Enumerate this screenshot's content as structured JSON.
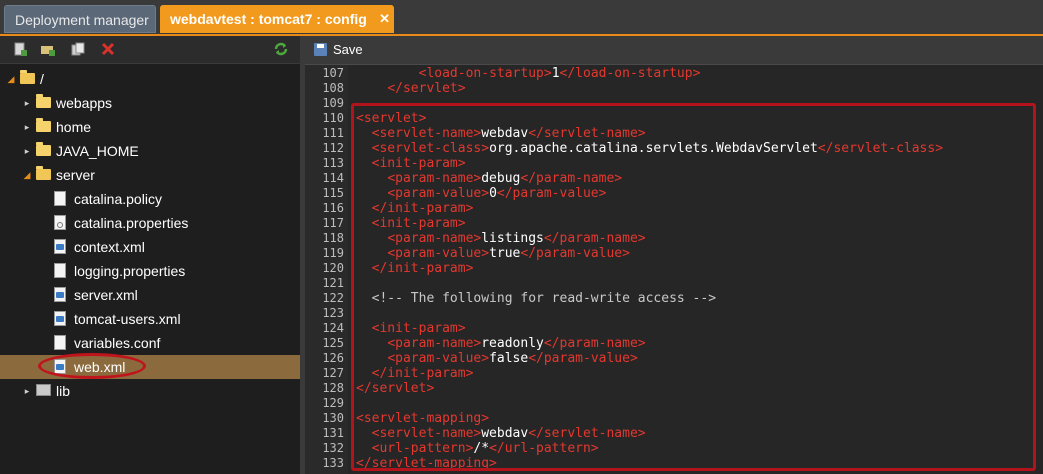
{
  "tabs": [
    {
      "label": "Deployment manager"
    },
    {
      "label": "webdavtest : tomcat7 : config",
      "close": "✕"
    }
  ],
  "tree": {
    "items": [
      {
        "label": "/",
        "kind": "folder-open",
        "depth": 0,
        "expanded": true
      },
      {
        "label": "webapps",
        "kind": "folder",
        "depth": 1,
        "expanded": false
      },
      {
        "label": "home",
        "kind": "folder",
        "depth": 1,
        "expanded": false
      },
      {
        "label": "JAVA_HOME",
        "kind": "folder",
        "depth": 1,
        "expanded": false
      },
      {
        "label": "server",
        "kind": "folder-open",
        "depth": 1,
        "expanded": true
      },
      {
        "label": "catalina.policy",
        "kind": "file",
        "depth": 2
      },
      {
        "label": "catalina.properties",
        "kind": "conf",
        "depth": 2
      },
      {
        "label": "context.xml",
        "kind": "xml",
        "depth": 2
      },
      {
        "label": "logging.properties",
        "kind": "file",
        "depth": 2
      },
      {
        "label": "server.xml",
        "kind": "xml",
        "depth": 2
      },
      {
        "label": "tomcat-users.xml",
        "kind": "xml",
        "depth": 2
      },
      {
        "label": "variables.conf",
        "kind": "file",
        "depth": 2
      },
      {
        "label": "web.xml",
        "kind": "xml",
        "depth": 2,
        "selected": true
      },
      {
        "label": "lib",
        "kind": "lib",
        "depth": 1,
        "expanded": false
      }
    ]
  },
  "toolbar": {
    "save_label": "Save"
  },
  "icons": {
    "add_file": "add-file-icon",
    "add_folder": "add-folder-icon",
    "copy": "copy-icon",
    "delete": "delete-icon",
    "refresh": "refresh-icon"
  },
  "editor": {
    "lines": [
      {
        "n": "107",
        "indent": "        ",
        "parts": [
          [
            "tag",
            "<load-on-startup>"
          ],
          [
            "txt",
            "1"
          ],
          [
            "tag",
            "</load-on-startup>"
          ]
        ]
      },
      {
        "n": "108",
        "indent": "    ",
        "parts": [
          [
            "tag",
            "</servlet>"
          ]
        ]
      },
      {
        "n": "109",
        "indent": "",
        "parts": []
      },
      {
        "n": "110",
        "indent": "",
        "parts": [
          [
            "tag",
            "<servlet>"
          ]
        ]
      },
      {
        "n": "111",
        "indent": "  ",
        "parts": [
          [
            "tag",
            "<servlet-name>"
          ],
          [
            "txt",
            "webdav"
          ],
          [
            "tag",
            "</servlet-name>"
          ]
        ]
      },
      {
        "n": "112",
        "indent": "  ",
        "parts": [
          [
            "tag",
            "<servlet-class>"
          ],
          [
            "txt",
            "org.apache.catalina.servlets.WebdavServlet"
          ],
          [
            "tag",
            "</servlet-class>"
          ]
        ]
      },
      {
        "n": "113",
        "indent": "  ",
        "parts": [
          [
            "tag",
            "<init-param>"
          ]
        ]
      },
      {
        "n": "114",
        "indent": "    ",
        "parts": [
          [
            "tag",
            "<param-name>"
          ],
          [
            "txt",
            "debug"
          ],
          [
            "tag",
            "</param-name>"
          ]
        ]
      },
      {
        "n": "115",
        "indent": "    ",
        "parts": [
          [
            "tag",
            "<param-value>"
          ],
          [
            "txt",
            "0"
          ],
          [
            "tag",
            "</param-value>"
          ]
        ]
      },
      {
        "n": "116",
        "indent": "  ",
        "parts": [
          [
            "tag",
            "</init-param>"
          ]
        ]
      },
      {
        "n": "117",
        "indent": "  ",
        "parts": [
          [
            "tag",
            "<init-param>"
          ]
        ]
      },
      {
        "n": "118",
        "indent": "    ",
        "parts": [
          [
            "tag",
            "<param-name>"
          ],
          [
            "txt",
            "listings"
          ],
          [
            "tag",
            "</param-name>"
          ]
        ]
      },
      {
        "n": "119",
        "indent": "    ",
        "parts": [
          [
            "tag",
            "<param-value>"
          ],
          [
            "txt",
            "true"
          ],
          [
            "tag",
            "</param-value>"
          ]
        ]
      },
      {
        "n": "120",
        "indent": "  ",
        "parts": [
          [
            "tag",
            "</init-param>"
          ]
        ]
      },
      {
        "n": "121",
        "indent": "",
        "parts": []
      },
      {
        "n": "122",
        "indent": "  ",
        "parts": [
          [
            "cmt",
            "<!-- The following for read-write access -->"
          ]
        ]
      },
      {
        "n": "123",
        "indent": "",
        "parts": []
      },
      {
        "n": "124",
        "indent": "  ",
        "parts": [
          [
            "tag",
            "<init-param>"
          ]
        ]
      },
      {
        "n": "125",
        "indent": "    ",
        "parts": [
          [
            "tag",
            "<param-name>"
          ],
          [
            "txt",
            "readonly"
          ],
          [
            "tag",
            "</param-name>"
          ]
        ]
      },
      {
        "n": "126",
        "indent": "    ",
        "parts": [
          [
            "tag",
            "<param-value>"
          ],
          [
            "txt",
            "false"
          ],
          [
            "tag",
            "</param-value>"
          ]
        ]
      },
      {
        "n": "127",
        "indent": "  ",
        "parts": [
          [
            "tag",
            "</init-param>"
          ]
        ]
      },
      {
        "n": "128",
        "indent": "",
        "parts": [
          [
            "tag",
            "</servlet>"
          ]
        ]
      },
      {
        "n": "129",
        "indent": "",
        "parts": []
      },
      {
        "n": "130",
        "indent": "",
        "parts": [
          [
            "tag",
            "<servlet-mapping>"
          ]
        ]
      },
      {
        "n": "131",
        "indent": "  ",
        "parts": [
          [
            "tag",
            "<servlet-name>"
          ],
          [
            "txt",
            "webdav"
          ],
          [
            "tag",
            "</servlet-name>"
          ]
        ]
      },
      {
        "n": "132",
        "indent": "  ",
        "parts": [
          [
            "tag",
            "<url-pattern>"
          ],
          [
            "txt",
            "/*"
          ],
          [
            "tag",
            "</url-pattern>"
          ]
        ]
      },
      {
        "n": "133",
        "indent": "",
        "parts": [
          [
            "tag",
            "</servlet-mapping>"
          ]
        ]
      }
    ]
  },
  "colors": {
    "accent": "#f29a1d",
    "highlight_box": "#b3141c",
    "selected_row": "#8b6a3e",
    "tag_text": "#e3382f"
  }
}
